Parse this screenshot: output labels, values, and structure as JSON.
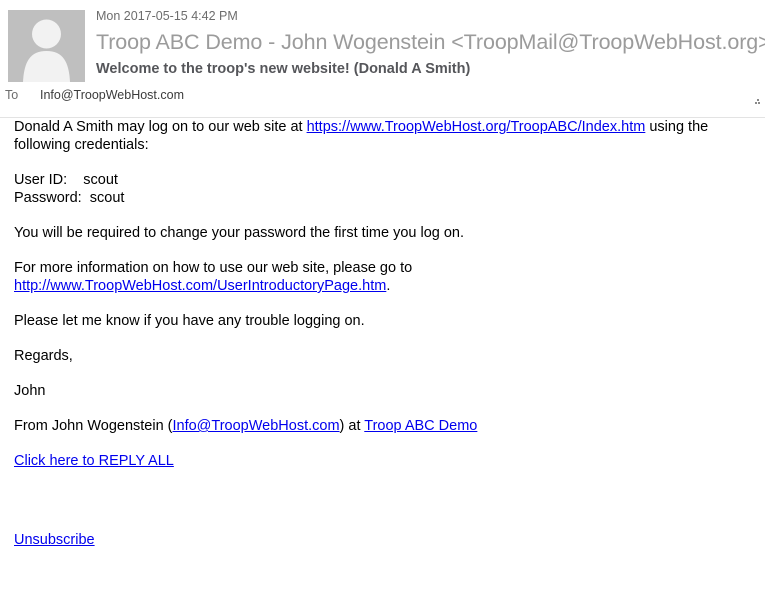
{
  "header": {
    "date": "Mon 2017-05-15 4:42 PM",
    "sender": "Troop ABC Demo - John Wogenstein <TroopMail@TroopWebHost.org>",
    "subject": "Welcome to the troop's new website! (Donald A Smith)",
    "to_label": "To",
    "to_value": "Info@TroopWebHost.com",
    "avatar_icon": "person-avatar-icon",
    "resize_icon": "resize-grip-icon"
  },
  "body": {
    "intro_before_link": "Donald A Smith may log on to our web site at ",
    "intro_link": "https://www.TroopWebHost.org/TroopABC/Index.htm",
    "intro_after_link": " using the following credentials:",
    "credentials": "User ID:    scout\nPassword:  scout",
    "password_notice": "You will be required to change your password the first time you log on.",
    "more_info_text": "For more information on how to use our web site, please go to",
    "more_info_link": "http://www.TroopWebHost.com/UserIntroductoryPage.htm",
    "more_info_trailing": ".",
    "trouble_notice": "Please let me know if you have any trouble logging on.",
    "signoff": "Regards,",
    "signature_name": "John",
    "from_prefix": "From John Wogenstein (",
    "from_email_link": "Info@TroopWebHost.com",
    "from_middle": ") at ",
    "from_troop_link": "Troop ABC Demo",
    "reply_all_link": "Click here to REPLY ALL",
    "unsubscribe_link": "Unsubscribe"
  },
  "colors": {
    "link": "#0000ee",
    "sender_text": "#9b9b9b",
    "subject_text": "#55565a",
    "meta_text": "#6d6d6d",
    "avatar_bg": "#bfbfbf",
    "rule": "#e3e3e3"
  }
}
